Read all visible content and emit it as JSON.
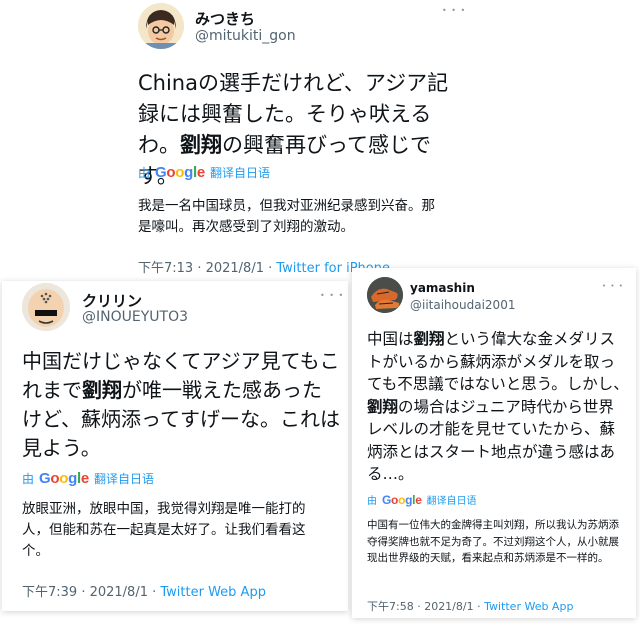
{
  "colors": {
    "link": "#1d9bf0",
    "secondary": "#536471",
    "text": "#0f1419"
  },
  "google_letters": [
    {
      "ch": "G",
      "color": "#4285f4"
    },
    {
      "ch": "o",
      "color": "#ea4335"
    },
    {
      "ch": "o",
      "color": "#fbbc05"
    },
    {
      "ch": "g",
      "color": "#4285f4"
    },
    {
      "ch": "l",
      "color": "#34a853"
    },
    {
      "ch": "e",
      "color": "#ea4335"
    }
  ],
  "tweet1": {
    "name": "みつきち",
    "handle": "@mitukiti_gon",
    "more": "• • •",
    "body_pre": "Chinaの選手だけれど、アジア記録には興奮した。そりゃ吠えるわ。",
    "body_bold": "劉翔",
    "body_post": "の興奮再びって感じです。",
    "translate_by": "由",
    "translate_label": "翻译自日语",
    "translation": "我是一名中国球员，但我对亚洲纪录感到兴奋。那是嚎叫。再次感受到了刘翔的激动。",
    "time": "下午7:13 · 2021/8/1 · ",
    "source": "Twitter for iPhone"
  },
  "tweet2": {
    "name": "クリリン",
    "handle": "@INOUEYUTO3",
    "more": "• • •",
    "body_pre": "中国だけじゃなくてアジア見てもこれまで",
    "body_bold": "劉翔",
    "body_post": "が唯一戦えた感あったけど、蘇炳添ってすげーな。これは見よう。",
    "translate_by": "由",
    "translate_label": "翻译自日语",
    "translation": "放眼亚洲，放眼中国，我觉得刘翔是唯一能打的人，但能和苏在一起真是太好了。让我们看看这个。",
    "time": "下午7:39 · 2021/8/1 · ",
    "source": "Twitter Web App"
  },
  "tweet3": {
    "name": "yamashin",
    "handle": "@iitaihoudai2001",
    "more": "• • •",
    "body_1": "中国は",
    "body_bold1": "劉翔",
    "body_2": "という偉大な金メダリストがいるから蘇炳添がメダルを取っても不思議ではないと思う。しかし、",
    "body_bold2": "劉翔",
    "body_3": "の場合はジュニア時代から世界レベルの才能を見せていたから、蘇炳添とはスタート地点が違う感はある…。",
    "translate_by": "由",
    "translate_label": "翻译自日语",
    "translation": "中国有一位伟大的金牌得主叫刘翔，所以我认为苏炳添夺得奖牌也就不足为奇了。不过刘翔这个人，从小就展现出世界级的天赋，看来起点和苏炳添是不一样的。",
    "time": "下午7:58 · 2021/8/1 · ",
    "source": "Twitter Web App"
  }
}
